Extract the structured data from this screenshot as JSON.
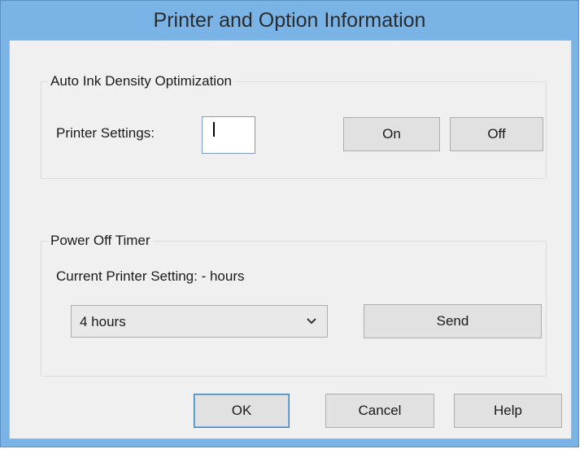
{
  "dialog": {
    "title": "Printer and Option Information"
  },
  "ink_density": {
    "group_title": "Auto Ink Density Optimization",
    "printer_settings_label": "Printer Settings:",
    "printer_settings_value": "",
    "on_label": "On",
    "off_label": "Off"
  },
  "power_timer": {
    "group_title": "Power Off Timer",
    "current_setting_label": "Current Printer Setting: - hours",
    "selected_option": "4 hours",
    "send_label": "Send"
  },
  "footer": {
    "ok_label": "OK",
    "cancel_label": "Cancel",
    "help_label": "Help"
  },
  "colors": {
    "title_bar": "#7ab4e6",
    "client_bg": "#f0f0f0",
    "button_bg": "#e1e1e1",
    "default_border": "#3c7fb1"
  },
  "icons": {
    "dropdown": "chevron-down-icon"
  }
}
